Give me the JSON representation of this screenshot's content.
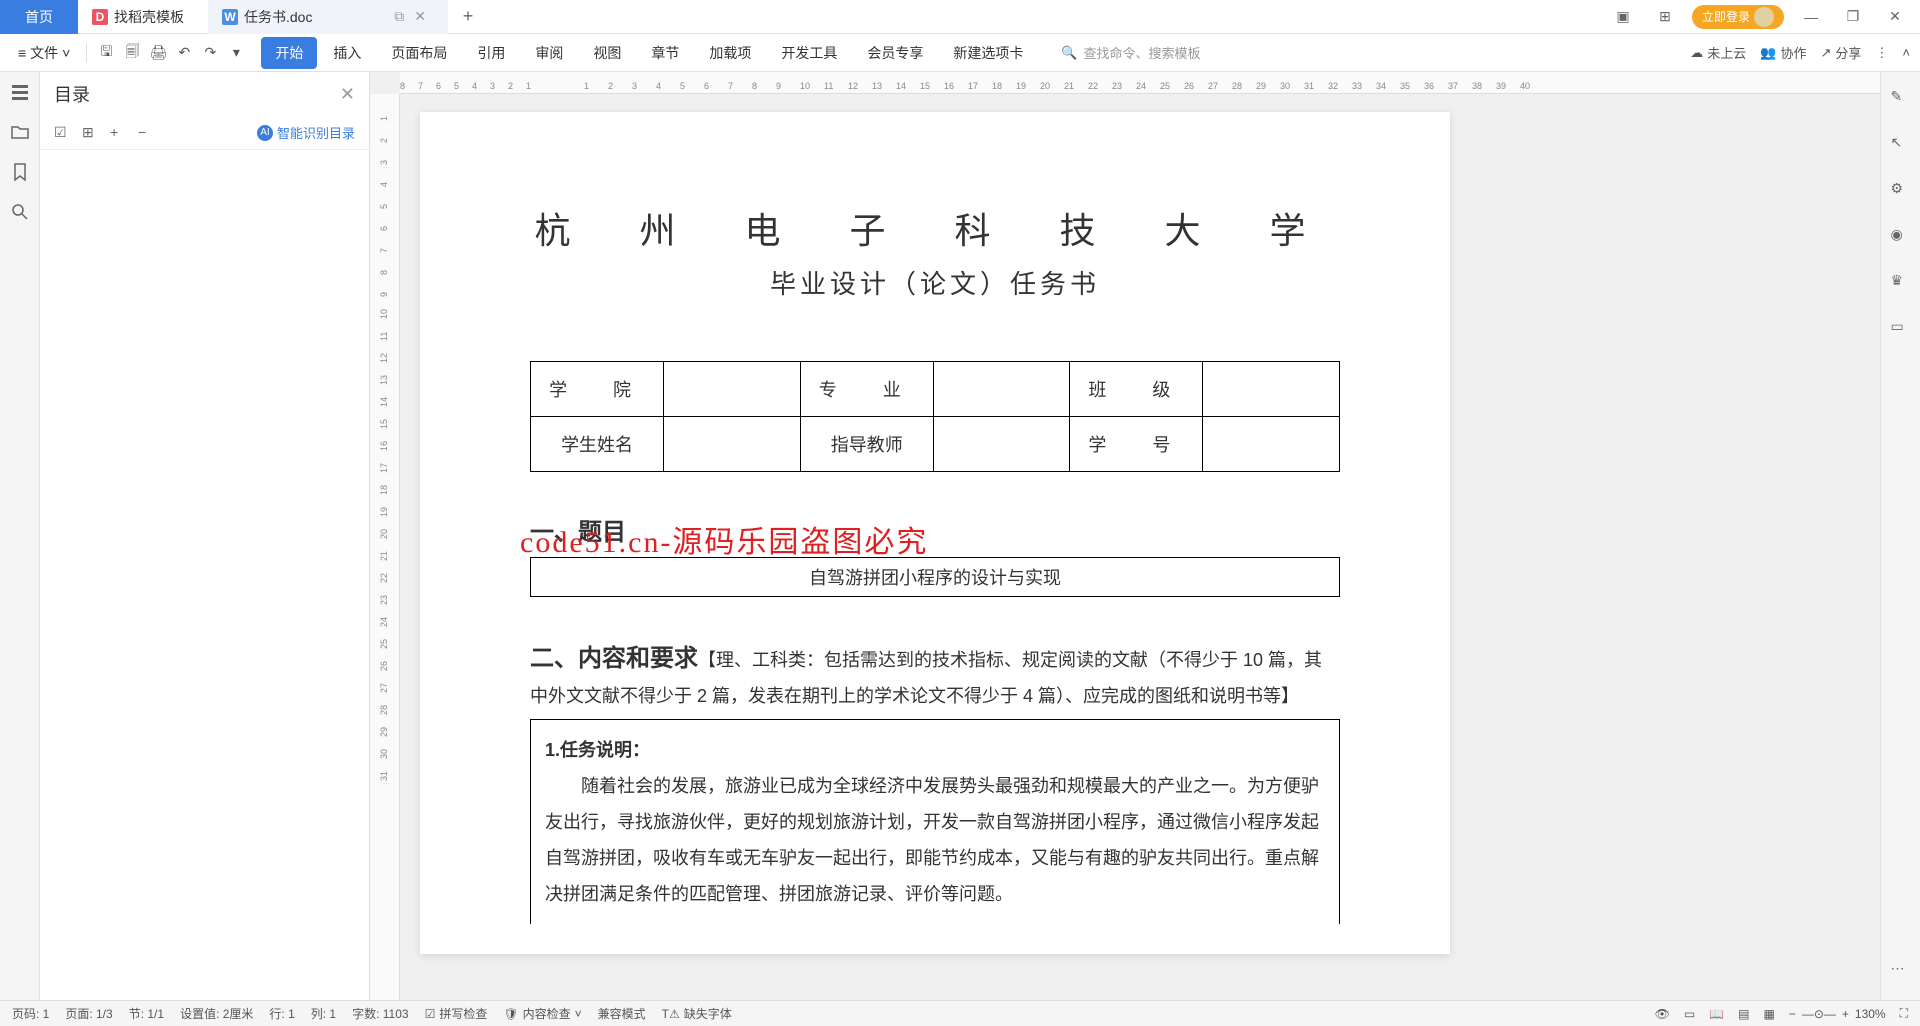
{
  "tabs": {
    "home": "首页",
    "store": "找稻壳模板",
    "doc": "任务书.doc"
  },
  "menu": {
    "file": "文件"
  },
  "ribbon": [
    "开始",
    "插入",
    "页面布局",
    "引用",
    "审阅",
    "视图",
    "章节",
    "加载项",
    "开发工具",
    "会员专享",
    "新建选项卡"
  ],
  "search_placeholder": "查找命令、搜索模板",
  "cloud": "未上云",
  "collab": "协作",
  "share": "分享",
  "login": "立即登录",
  "sidebar": {
    "title": "目录",
    "smart": "智能识别目录"
  },
  "doc": {
    "university": "杭 州 电 子 科 技 大 学",
    "subtitle": "毕业设计（论文）任务书",
    "labels": {
      "college": "学　院",
      "major": "专　业",
      "class": "班　级",
      "name": "学生姓名",
      "teacher": "指导教师",
      "id": "学　号"
    },
    "section1": "一、题目",
    "topic": "自驾游拼团小程序的设计与实现",
    "section2_head": "二、内容和要求",
    "section2_note": "【理、工科类：包括需达到的技术指标、规定阅读的文献（不得少于 10 篇，其中外文文献不得少于 2 篇，发表在期刊上的学术论文不得少于 4 篇）、应完成的图纸和说明书等】",
    "task_label": "1.任务说明：",
    "task_body": "随着社会的发展，旅游业已成为全球经济中发展势头最强劲和规模最大的产业之一。为方便驴友出行，寻找旅游伙伴，更好的规划旅游计划，开发一款自驾游拼团小程序，通过微信小程序发起自驾游拼团，吸收有车或无车驴友一起出行，即能节约成本，又能与有趣的驴友共同出行。重点解决拼团满足条件的匹配管理、拼团旅游记录、评价等问题。"
  },
  "watermark": "code51.cn-源码乐园盗图必究",
  "status": {
    "page_no": "页码: 1",
    "page": "页面: 1/3",
    "sec": "节: 1/1",
    "pos": "设置值: 2厘米",
    "row": "行: 1",
    "col": "列: 1",
    "words": "字数: 1103",
    "spell": "拼写检查",
    "content": "内容检查",
    "compat": "兼容模式",
    "font": "缺失字体",
    "zoom": "130%"
  }
}
